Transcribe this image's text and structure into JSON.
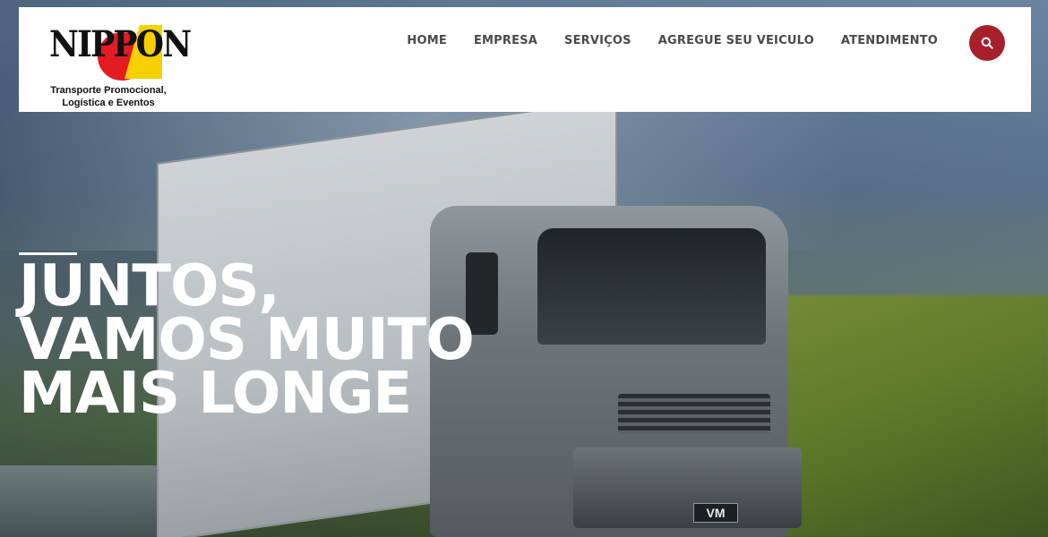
{
  "brand": {
    "name": "NIPPON",
    "tagline_line1": "Transporte Promocional,",
    "tagline_line2": "Logística e Eventos"
  },
  "nav": {
    "items": [
      {
        "label": "HOME"
      },
      {
        "label": "EMPRESA"
      },
      {
        "label": "SERVIÇOS"
      },
      {
        "label": "AGREGUE SEU VEICULO"
      },
      {
        "label": "ATENDIMENTO"
      }
    ],
    "search_icon": "search-icon"
  },
  "hero": {
    "headline_line1": "JUNTOS,",
    "headline_line2": "VAMOS MUITO",
    "headline_line3": "MAIS LONGE",
    "truck_plate": "VM"
  },
  "colors": {
    "accent": "#a81f2c",
    "logo_red": "#e31b23",
    "logo_yellow": "#f6d000",
    "header_bg": "#ffffff",
    "nav_text": "#4a4a4a"
  }
}
